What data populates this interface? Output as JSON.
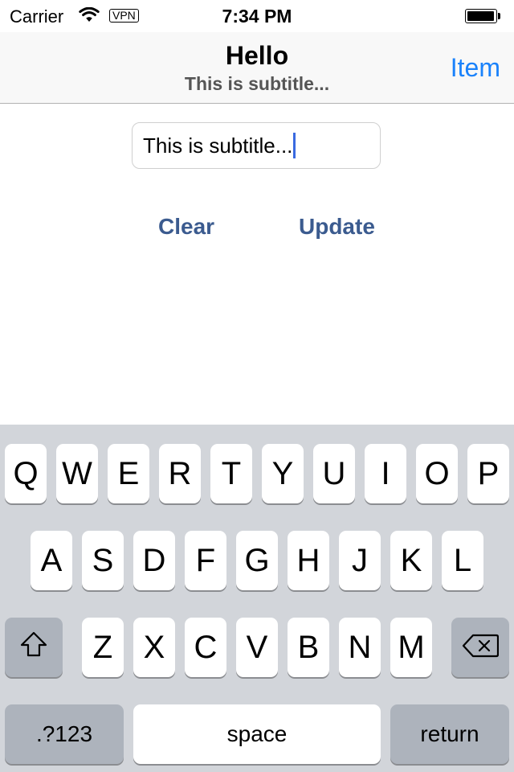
{
  "status": {
    "carrier": "Carrier",
    "vpn": "VPN",
    "time": "7:34 PM"
  },
  "nav": {
    "title": "Hello",
    "subtitle": "This is subtitle...",
    "right_item": "Item"
  },
  "content": {
    "text_value": "This is subtitle...",
    "clear_label": "Clear",
    "update_label": "Update"
  },
  "keyboard": {
    "row1": [
      "Q",
      "W",
      "E",
      "R",
      "T",
      "Y",
      "U",
      "I",
      "O",
      "P"
    ],
    "row2": [
      "A",
      "S",
      "D",
      "F",
      "G",
      "H",
      "J",
      "K",
      "L"
    ],
    "row3": [
      "Z",
      "X",
      "C",
      "V",
      "B",
      "N",
      "M"
    ],
    "numbers_label": ".?123",
    "space_label": "space",
    "return_label": "return",
    "shift_icon": "shift-icon",
    "backspace_icon": "backspace-icon"
  },
  "colors": {
    "nav_item": "#1a82fb",
    "button_text": "#3b5b8f",
    "keyboard_bg": "#d2d5da"
  }
}
